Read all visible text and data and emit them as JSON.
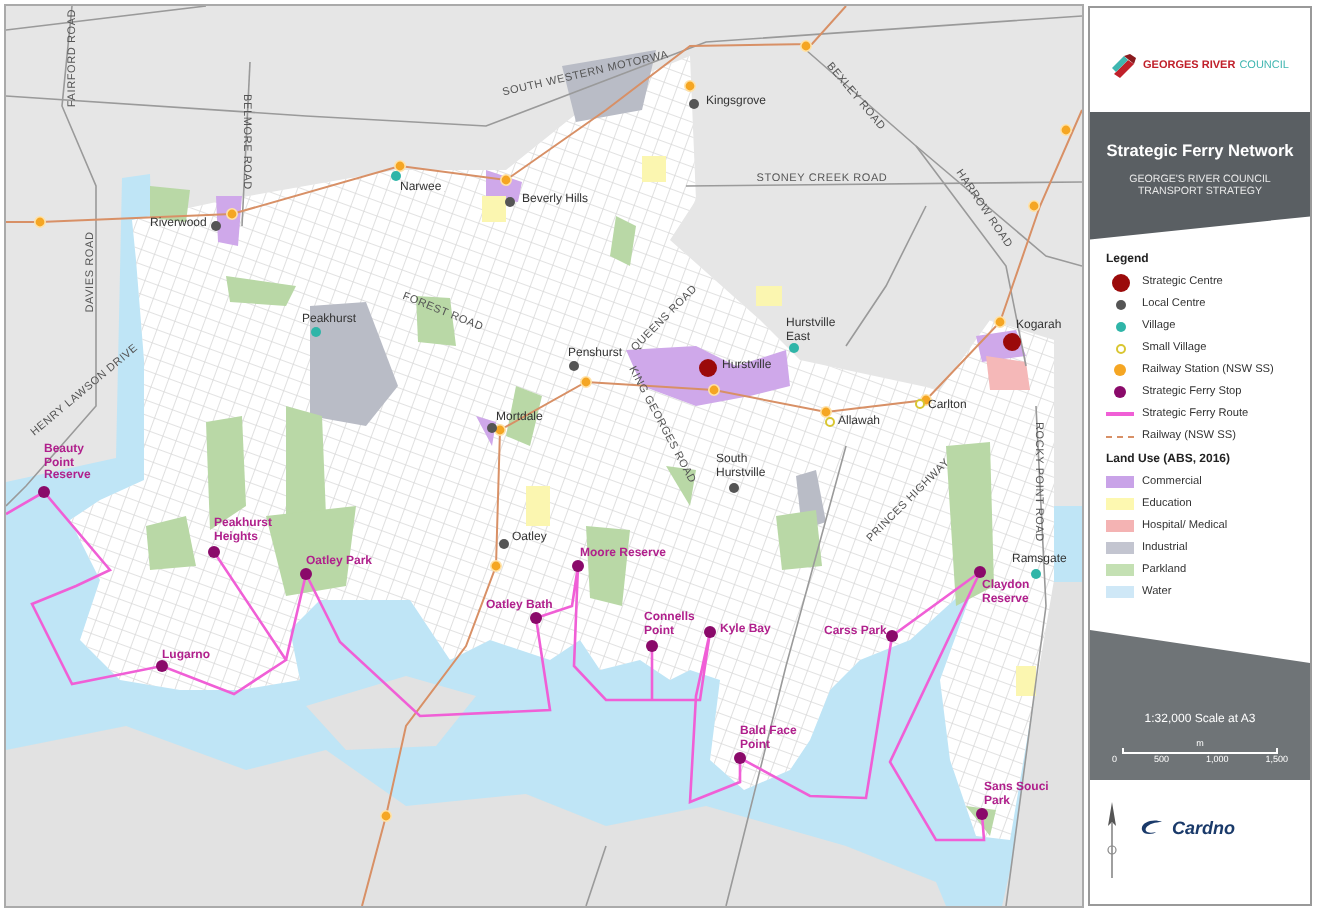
{
  "map": {
    "roads": [
      "FAIRFORD ROAD",
      "BELMORE ROAD",
      "SOUTH WESTERN MOTORWA",
      "BEXLEY ROAD",
      "STONEY CREEK ROAD",
      "HARROW ROAD",
      "DAVIES ROAD",
      "FOREST ROAD",
      "QUEENS ROAD",
      "HENRY LAWSON DRIVE",
      "KING GEORGES ROAD",
      "PRINCES HIGHWAY",
      "ROCKY POINT ROAD"
    ],
    "places": [
      {
        "name": "Kingsgrove",
        "kind": "local_centre"
      },
      {
        "name": "Narwee",
        "kind": "village"
      },
      {
        "name": "Beverly Hills",
        "kind": "local_centre"
      },
      {
        "name": "Riverwood",
        "kind": "local_centre"
      },
      {
        "name": "Peakhurst",
        "kind": "village"
      },
      {
        "name": "Penshurst",
        "kind": "local_centre"
      },
      {
        "name": "Hurstville",
        "kind": "strategic_centre"
      },
      {
        "name": "Hurstville East",
        "kind": "village"
      },
      {
        "name": "Kogarah",
        "kind": "strategic_centre"
      },
      {
        "name": "Mortdale",
        "kind": "local_centre"
      },
      {
        "name": "Allawah",
        "kind": "small_village"
      },
      {
        "name": "Carlton",
        "kind": "small_village"
      },
      {
        "name": "South Hurstville",
        "kind": "local_centre"
      },
      {
        "name": "Oatley",
        "kind": "local_centre"
      },
      {
        "name": "Ramsgate",
        "kind": "village"
      },
      {
        "name": "Beauty Point Reserve",
        "kind": "ferry_stop"
      },
      {
        "name": "Peakhurst Heights",
        "kind": "ferry_stop"
      },
      {
        "name": "Oatley Park",
        "kind": "ferry_stop"
      },
      {
        "name": "Lugarno",
        "kind": "ferry_stop"
      },
      {
        "name": "Moore Reserve",
        "kind": "ferry_stop"
      },
      {
        "name": "Oatley Bath",
        "kind": "ferry_stop"
      },
      {
        "name": "Connells Point",
        "kind": "ferry_stop"
      },
      {
        "name": "Kyle Bay",
        "kind": "ferry_stop"
      },
      {
        "name": "Carss Park",
        "kind": "ferry_stop"
      },
      {
        "name": "Claydon Reserve",
        "kind": "ferry_stop"
      },
      {
        "name": "Bald Face Point",
        "kind": "ferry_stop"
      },
      {
        "name": "Sans Souci Park",
        "kind": "ferry_stop"
      }
    ]
  },
  "panel": {
    "logo": {
      "name": "GEORGES RIVER",
      "suffix": "COUNCIL"
    },
    "title": "Strategic Ferry Network",
    "subtitle": "GEORGE'S RIVER COUNCIL TRANSPORT STRATEGY",
    "legend": {
      "heading": "Legend",
      "items": [
        {
          "label": "Strategic Centre",
          "kind": "strategic_centre"
        },
        {
          "label": "Local Centre",
          "kind": "local_centre"
        },
        {
          "label": "Village",
          "kind": "village"
        },
        {
          "label": "Small Village",
          "kind": "small_village"
        },
        {
          "label": "Railway Station (NSW SS)",
          "kind": "railway_station"
        },
        {
          "label": "Strategic Ferry Stop",
          "kind": "ferry_stop"
        },
        {
          "label": "Strategic Ferry Route",
          "kind": "ferry_route"
        },
        {
          "label": "Railway (NSW SS)",
          "kind": "railway"
        }
      ]
    },
    "land_use": {
      "heading": "Land Use (ABS, 2016)",
      "items": [
        {
          "label": "Commercial",
          "color": "#c9a3e8"
        },
        {
          "label": "Education",
          "color": "#fdf8b0"
        },
        {
          "label": "Hospital/ Medical",
          "color": "#f4b3b3"
        },
        {
          "label": "Industrial",
          "color": "#c3c5d0"
        },
        {
          "label": "Parkland",
          "color": "#c4e0b3"
        },
        {
          "label": "Water",
          "color": "#cfe8f7"
        }
      ]
    },
    "scale": {
      "text": "1:32,000 Scale at A3",
      "unit": "m",
      "ticks": [
        "0",
        "500",
        "1,000",
        "1,500"
      ]
    },
    "company": "Cardno"
  }
}
